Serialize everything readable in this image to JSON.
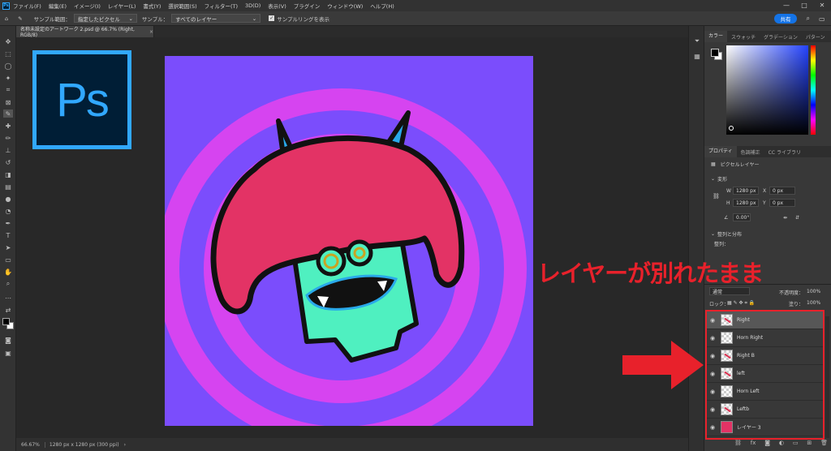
{
  "menubar": {
    "items": [
      "ファイル(F)",
      "編集(E)",
      "イメージ(I)",
      "レイヤー(L)",
      "書式(Y)",
      "選択範囲(S)",
      "フィルター(T)",
      "3D(D)",
      "表示(V)",
      "プラグイン",
      "ウィンドウ(W)",
      "ヘルプ(H)"
    ],
    "app_icon_text": "Ps",
    "minimize_icon": "—",
    "maximize_icon": "□",
    "close_icon": "✕"
  },
  "options": {
    "sample_size_label": "サンプル範囲：",
    "sample_size_value": "指定したピクセル",
    "sample_label": "サンプル：",
    "sample_value": "すべてのレイヤー",
    "show_ring_label": "サンプルリングを表示",
    "share_label": "共有"
  },
  "document": {
    "tab_title": "名称未設定のアートワーク 2.psd @ 66.7% (Right, RGB/8)",
    "tab_close": "×",
    "zoom": "66.67%",
    "size_info": "1280 px x 1280 px (300 ppi)"
  },
  "ps_logo_text": "Ps",
  "color_panel": {
    "tabs": [
      "カラー",
      "スウォッチ",
      "グラデーション",
      "パターン"
    ],
    "active_tab": 0
  },
  "properties_panel": {
    "tabs": [
      "プロパティ",
      "色調補正",
      "CC ライブラリ"
    ],
    "active_tab": 0,
    "layer_type": "ピクセルレイヤー",
    "transform_label": "変形",
    "w_label": "W",
    "w_value": "1280 px",
    "x_label": "X",
    "x_value": "0 px",
    "h_label": "H",
    "h_value": "1280 px",
    "y_label": "Y",
    "y_value": "0 px",
    "angle_value": "0.00°",
    "align_label": "整列と分布",
    "align_sub": "整列："
  },
  "layers_panel": {
    "blend_mode": "通常",
    "opacity_label": "不透明度：",
    "opacity_value": "100%",
    "lock_label": "ロック：",
    "fill_label": "塗り：",
    "fill_value": "100%",
    "layers": [
      {
        "name": "Right",
        "selected": true
      },
      {
        "name": "Horn Right",
        "selected": false
      },
      {
        "name": "Right B",
        "selected": false
      },
      {
        "name": "left",
        "selected": false
      },
      {
        "name": "Horn Left",
        "selected": false
      },
      {
        "name": "Leftb",
        "selected": false
      },
      {
        "name": "レイヤー 3",
        "selected": false
      }
    ]
  },
  "annotation": {
    "text": "レイヤーが別れたまま",
    "color": "#e8212b"
  },
  "colors": {
    "canvas_bg": "#7b4dfc",
    "ring_magenta": "#d644f0",
    "hair": "#e33365",
    "face": "#4ff0c0",
    "horn": "#29a9ea",
    "accent_blue": "#1473e6"
  }
}
